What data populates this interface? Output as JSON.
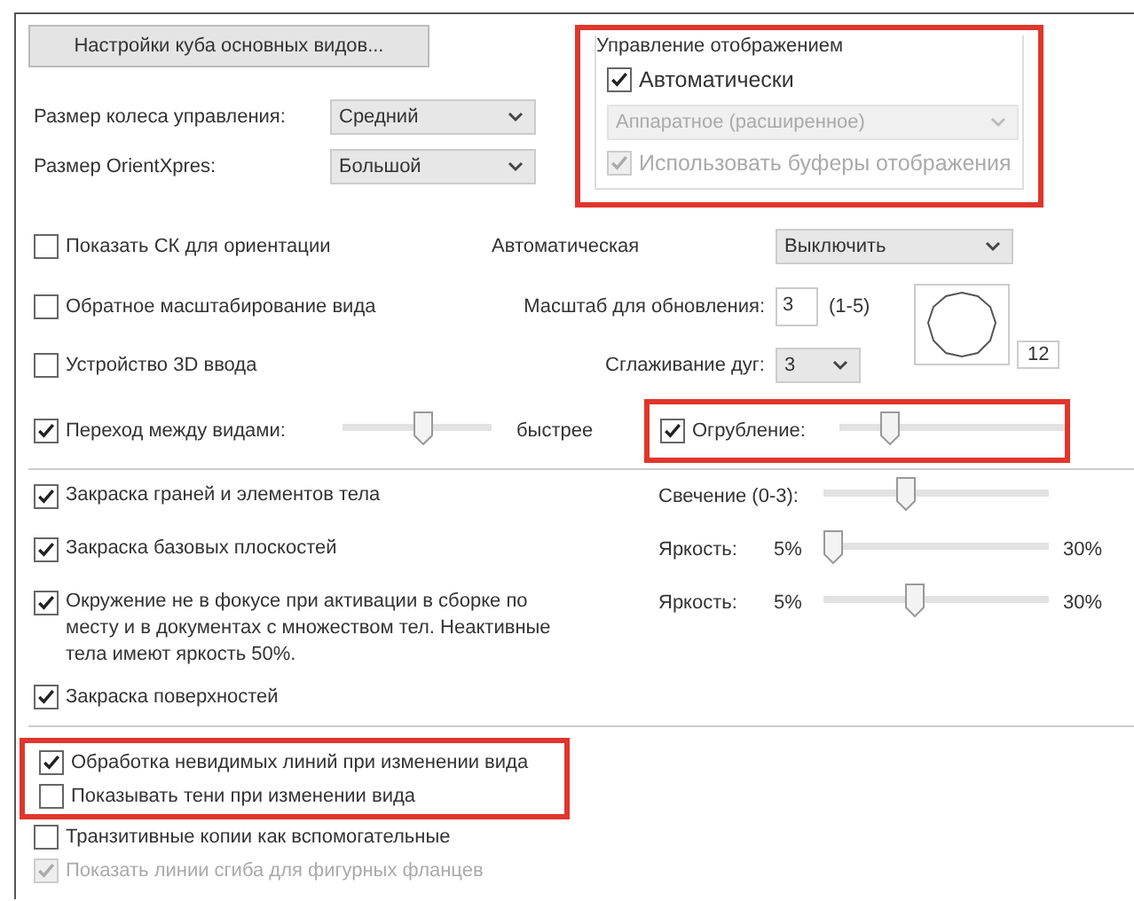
{
  "cube_button": "Настройки куба основных видов...",
  "selects": [
    {
      "label": "Размер колеса управления:",
      "value": "Средний"
    },
    {
      "label": "Размер OrientXpres:",
      "value": "Большой"
    }
  ],
  "display_group": {
    "title": "Управление отображением",
    "highlighted": true,
    "auto": {
      "label": "Автоматически",
      "checked": true
    },
    "mode": {
      "value": "Аппаратное (расширенное)",
      "disabled": true
    },
    "buffers": {
      "label": "Использовать буферы отображения",
      "checked": true,
      "disabled": true
    }
  },
  "orientation": {
    "label": "Показать СК для ориентации",
    "checked": false,
    "mode_label": "Автоматическая",
    "mode_value": "Выключить"
  },
  "reverse_zoom": {
    "label": "Обратное масштабирование вида",
    "checked": false,
    "scale_label": "Масштаб для обновления:",
    "scale_value": "3",
    "scale_range": "(1-5)"
  },
  "input_3d": {
    "label": "Устройство 3D ввода",
    "checked": false,
    "arc_label": "Сглаживание дуг:",
    "arc_value": "3",
    "preview_value": "12"
  },
  "transition": {
    "label": "Переход между видами:",
    "checked": true,
    "level": 0.55,
    "speed_label": "быстрее"
  },
  "coarsening": {
    "label": "Огрубление:",
    "checked": true,
    "level": 0.2,
    "highlighted": true
  },
  "shading_rows": [
    {
      "label": "Закраска граней и элементов тела",
      "checked": true,
      "control": {
        "kind": "slider",
        "label": "Свечение (0-3):",
        "level": 0.35
      }
    },
    {
      "label": "Закраска базовых плоскостей",
      "checked": true,
      "control": {
        "kind": "range",
        "label": "Яркость:",
        "min": "5%",
        "max": "30%",
        "level": 0
      }
    },
    {
      "label": "Окружение не в фокусе при активации в сборке по месту и в документах с множеством тел. Неактивные тела имеют яркость 50%.",
      "checked": true,
      "control": {
        "kind": "range",
        "label": "Яркость:",
        "min": "5%",
        "max": "30%",
        "level": 0.4
      }
    }
  ],
  "surfaces": {
    "label": "Закраска поверхностей",
    "checked": true
  },
  "highlighted_options": [
    {
      "label": "Обработка невидимых линий при изменении вида",
      "checked": true,
      "disabled": false
    },
    {
      "label": "Показывать тени при изменении вида",
      "checked": false,
      "disabled": false
    }
  ],
  "other_options": [
    {
      "label": "Транзитивные копии как вспомогательные",
      "checked": false,
      "disabled": false
    },
    {
      "label": "Показать линии сгиба для фигурных фланцев",
      "checked": true,
      "disabled": true
    }
  ]
}
